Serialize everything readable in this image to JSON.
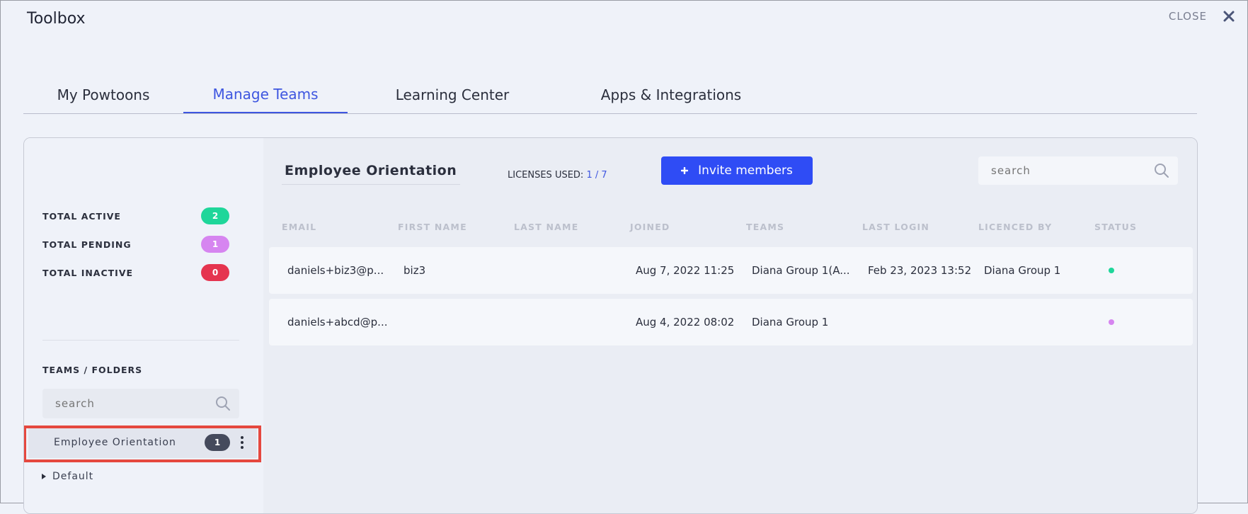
{
  "app": {
    "title": "Toolbox",
    "close_label": "CLOSE"
  },
  "tabs": [
    {
      "label": "My Powtoons",
      "active": false
    },
    {
      "label": "Manage Teams",
      "active": true
    },
    {
      "label": "Learning Center",
      "active": false
    },
    {
      "label": "Apps & Integrations",
      "active": false
    }
  ],
  "sidebar": {
    "stats": [
      {
        "label": "TOTAL ACTIVE",
        "count": "2",
        "color": "#1fd69a"
      },
      {
        "label": "TOTAL PENDING",
        "count": "1",
        "color": "#d685f0"
      },
      {
        "label": "TOTAL INACTIVE",
        "count": "0",
        "color": "#e5344f"
      }
    ],
    "section_title": "TEAMS / FOLDERS",
    "search_placeholder": "search",
    "teams": [
      {
        "label": "Employee Orientation",
        "count": "1",
        "selected": true
      }
    ],
    "folders": [
      {
        "label": "Default",
        "expanded": false
      }
    ]
  },
  "main": {
    "team_title": "Employee Orientation",
    "licenses_label": "LICENSES USED:",
    "licenses_value": "1 / 7",
    "invite_label": "Invite members",
    "search_placeholder": "search",
    "columns": [
      "EMAIL",
      "FIRST NAME",
      "LAST NAME",
      "JOINED",
      "TEAMS",
      "LAST LOGIN",
      "LICENCED BY",
      "STATUS"
    ],
    "rows": [
      {
        "email": "daniels+biz3@p...",
        "first_name": "biz3",
        "last_name": "",
        "joined": "Aug 7, 2022 11:25",
        "teams": "Diana Group 1(A...",
        "last_login": "Feb 23, 2023 13:52",
        "licenced_by": "Diana Group 1",
        "status": "active",
        "status_color": "#1fd69a"
      },
      {
        "email": "daniels+abcd@p...",
        "first_name": "",
        "last_name": "",
        "joined": "Aug 4, 2022 08:02",
        "teams": "Diana Group 1",
        "last_login": "",
        "licenced_by": "",
        "status": "pending",
        "status_color": "#d685f0"
      }
    ]
  }
}
